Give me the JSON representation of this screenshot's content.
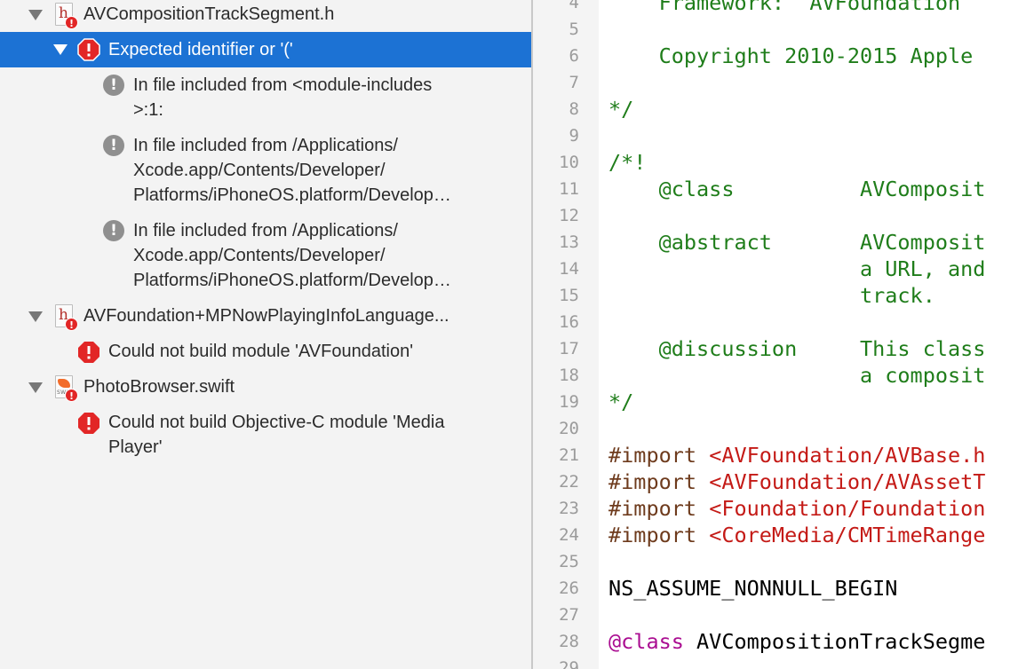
{
  "navigator": {
    "rows": [
      {
        "kind": "file",
        "label": "AVCompositionTrackSegment.h",
        "icon": "header-file-icon"
      },
      {
        "kind": "error",
        "label": "Expected identifier or '('",
        "selected": true
      },
      {
        "kind": "note",
        "label": "In file included from <module-includes>:1:"
      },
      {
        "kind": "note",
        "label": "In file included from /Applications/Xcode.app/Contents/Developer/Platforms/iPhoneOS.platform/Develop..."
      },
      {
        "kind": "note",
        "label": "In file included from /Applications/Xcode.app/Contents/Developer/Platforms/iPhoneOS.platform/Develop..."
      },
      {
        "kind": "file",
        "label": "AVFoundation+MPNowPlayingInfoLanguage...",
        "icon": "header-file-icon"
      },
      {
        "kind": "error",
        "label": "Could not build module 'AVFoundation'"
      },
      {
        "kind": "file",
        "label": "PhotoBrowser.swift",
        "icon": "swift-file-icon"
      },
      {
        "kind": "error",
        "label": "Could not build Objective-C module 'Media Player'"
      }
    ],
    "note_lines": {
      "n1": [
        "In file included from <module-includes",
        ">:1:"
      ],
      "n2": [
        "In file included from /Applications/",
        "Xcode.app/Contents/Developer/",
        "Platforms/iPhoneOS.platform/Develop…"
      ],
      "n3": [
        "In file included from /Applications/",
        "Xcode.app/Contents/Developer/",
        "Platforms/iPhoneOS.platform/Develop…"
      ]
    },
    "error_lines": {
      "e3": [
        "Could not build Objective-C module 'Media",
        "Player'"
      ]
    },
    "file_glyph": "h",
    "swift_label": "SWIFT",
    "badge": "!",
    "note_glyph": "!",
    "colors": {
      "selection": "#1c72d4",
      "error": "#e22626",
      "note": "#8f8f8f",
      "comment": "#1f7d1a",
      "string": "#c41a16",
      "keyword": "#aa0d91",
      "directive": "#6e3b1d"
    }
  },
  "editor": {
    "lines": [
      {
        "n": "4",
        "parts": [
          {
            "t": "    Framework:  AVFoundation",
            "c": "comment"
          }
        ]
      },
      {
        "n": "5",
        "parts": []
      },
      {
        "n": "6",
        "parts": [
          {
            "t": "    Copyright 2010-2015 Apple",
            "c": "comment"
          }
        ]
      },
      {
        "n": "7",
        "parts": []
      },
      {
        "n": "8",
        "parts": [
          {
            "t": "*/",
            "c": "comment"
          }
        ]
      },
      {
        "n": "9",
        "parts": []
      },
      {
        "n": "10",
        "parts": [
          {
            "t": "/*!",
            "c": "comment"
          }
        ]
      },
      {
        "n": "11",
        "parts": [
          {
            "t": "    @class          AVComposit",
            "c": "comment"
          }
        ]
      },
      {
        "n": "12",
        "parts": []
      },
      {
        "n": "13",
        "parts": [
          {
            "t": "    @abstract       AVComposit",
            "c": "comment"
          }
        ]
      },
      {
        "n": "14",
        "parts": [
          {
            "t": "                    a URL, and",
            "c": "comment"
          }
        ]
      },
      {
        "n": "15",
        "parts": [
          {
            "t": "                    track.",
            "c": "comment"
          }
        ]
      },
      {
        "n": "16",
        "parts": []
      },
      {
        "n": "17",
        "parts": [
          {
            "t": "    @discussion     This class",
            "c": "comment"
          }
        ]
      },
      {
        "n": "18",
        "parts": [
          {
            "t": "                    a composit",
            "c": "comment"
          }
        ]
      },
      {
        "n": "19",
        "parts": [
          {
            "t": "*/",
            "c": "comment"
          }
        ]
      },
      {
        "n": "20",
        "parts": []
      },
      {
        "n": "21",
        "parts": [
          {
            "t": "#import ",
            "c": "directive"
          },
          {
            "t": "<AVFoundation/AVBase.h",
            "c": "string"
          }
        ]
      },
      {
        "n": "22",
        "parts": [
          {
            "t": "#import ",
            "c": "directive"
          },
          {
            "t": "<AVFoundation/AVAssetT",
            "c": "string"
          }
        ]
      },
      {
        "n": "23",
        "parts": [
          {
            "t": "#import ",
            "c": "directive"
          },
          {
            "t": "<Foundation/Foundation",
            "c": "string"
          }
        ]
      },
      {
        "n": "24",
        "parts": [
          {
            "t": "#import ",
            "c": "directive"
          },
          {
            "t": "<CoreMedia/CMTimeRange",
            "c": "string"
          }
        ]
      },
      {
        "n": "25",
        "parts": []
      },
      {
        "n": "26",
        "parts": [
          {
            "t": "NS_ASSUME_NONNULL_BEGIN",
            "c": "plain"
          }
        ]
      },
      {
        "n": "27",
        "parts": []
      },
      {
        "n": "28",
        "parts": [
          {
            "t": "@class",
            "c": "keyword"
          },
          {
            "t": " AVCompositionTrackSegme",
            "c": "plain"
          }
        ]
      },
      {
        "n": "29",
        "parts": []
      }
    ]
  }
}
